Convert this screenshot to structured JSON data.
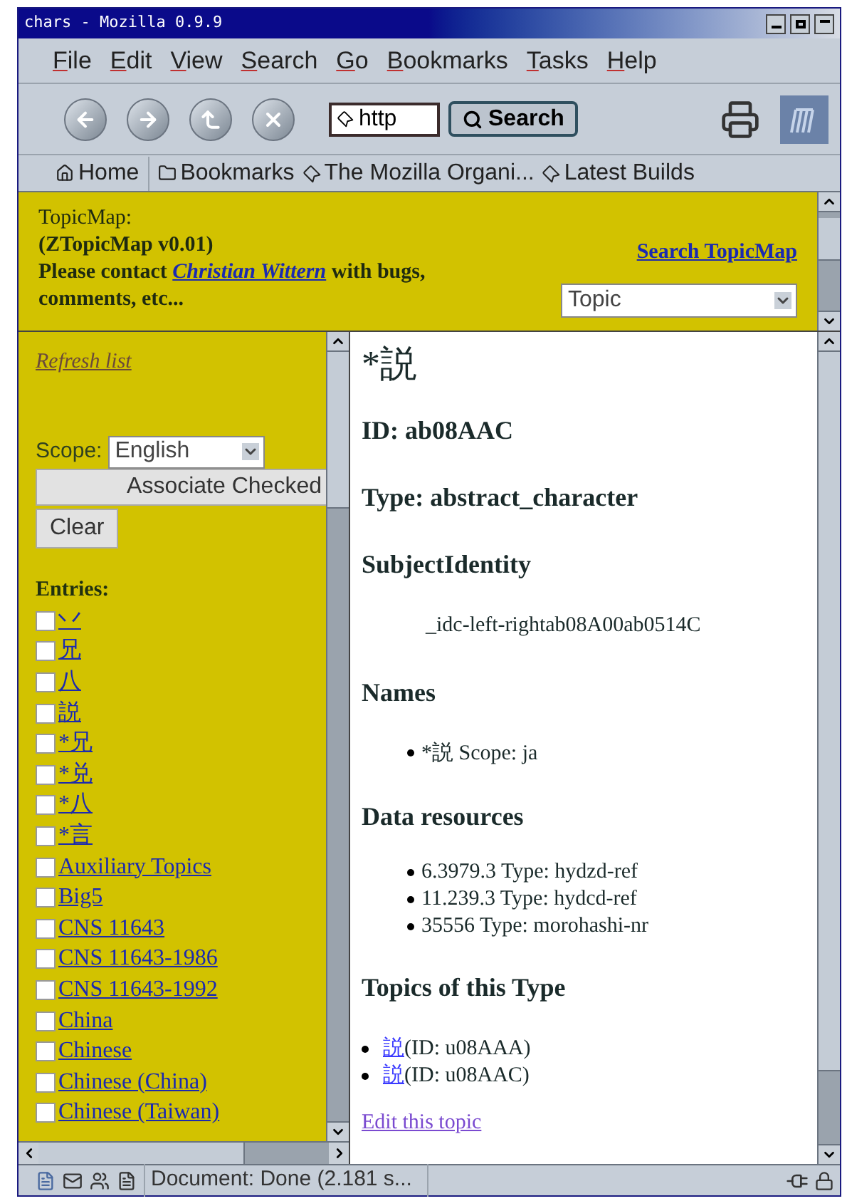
{
  "window": {
    "title": "chars - Mozilla 0.9.9"
  },
  "menu": [
    "File",
    "Edit",
    "View",
    "Search",
    "Go",
    "Bookmarks",
    "Tasks",
    "Help"
  ],
  "toolbar": {
    "url_field": "http",
    "search_button": "Search"
  },
  "personal_toolbar": [
    {
      "label": "Home",
      "kind": "home"
    },
    {
      "label": "Bookmarks",
      "kind": "folder"
    },
    {
      "label": "The Mozilla Organi...",
      "kind": "link"
    },
    {
      "label": "Latest Builds",
      "kind": "link"
    }
  ],
  "header": {
    "title": "TopicMap:",
    "subtitle": "(ZTopicMap v0.01)",
    "contact_before": "Please contact",
    "contact_link": "Christian Wittern",
    "contact_after": "with bugs, comments, etc...",
    "search_link": "Search TopicMap",
    "search_type": "Topic"
  },
  "sidebar": {
    "refresh": "Refresh list",
    "scope_label": "Scope:",
    "scope": "English",
    "associate_button": "Associate Checked",
    "clear_button": "Clear",
    "entries_heading": "Entries:",
    "entries": [
      {
        "label": "丷",
        "checked": false
      },
      {
        "label": "兄",
        "checked": false
      },
      {
        "label": "八",
        "checked": false
      },
      {
        "label": "説",
        "checked": false
      },
      {
        "label": "*兄",
        "checked": false
      },
      {
        "label": "*兑",
        "checked": false
      },
      {
        "label": "*八",
        "checked": false
      },
      {
        "label": "*言",
        "checked": false
      },
      {
        "label": "Auxiliary Topics",
        "checked": false
      },
      {
        "label": "Big5",
        "checked": false
      },
      {
        "label": "CNS 11643",
        "checked": false
      },
      {
        "label": "CNS 11643-1986",
        "checked": false
      },
      {
        "label": "CNS 11643-1992",
        "checked": false
      },
      {
        "label": "China",
        "checked": false
      },
      {
        "label": "Chinese",
        "checked": false
      },
      {
        "label": "Chinese (China)",
        "checked": false
      },
      {
        "label": "Chinese (Taiwan)",
        "checked": false
      }
    ]
  },
  "topic": {
    "title": "*説",
    "id": "ID: ab08AAC",
    "type": "Type: abstract_character",
    "subject_heading": "SubjectIdentity",
    "subject": "_idc-left-rightab08A00ab0514C",
    "names_heading": "Names",
    "names": [
      "*説 Scope: ja"
    ],
    "resources_heading": "Data resources",
    "resources": [
      "6.3979.3 Type: hydzd-ref",
      "11.239.3 Type: hydcd-ref",
      "35556 Type: morohashi-nr"
    ],
    "topics_heading": "Topics of this Type",
    "topics": [
      {
        "link": "説",
        "text": "(ID: u08AAA)"
      },
      {
        "link": "説",
        "text": "(ID: u08AAC)"
      }
    ],
    "edit_link": "Edit this topic"
  },
  "status_bar": {
    "text": "Document: Done (2.181 s..."
  }
}
